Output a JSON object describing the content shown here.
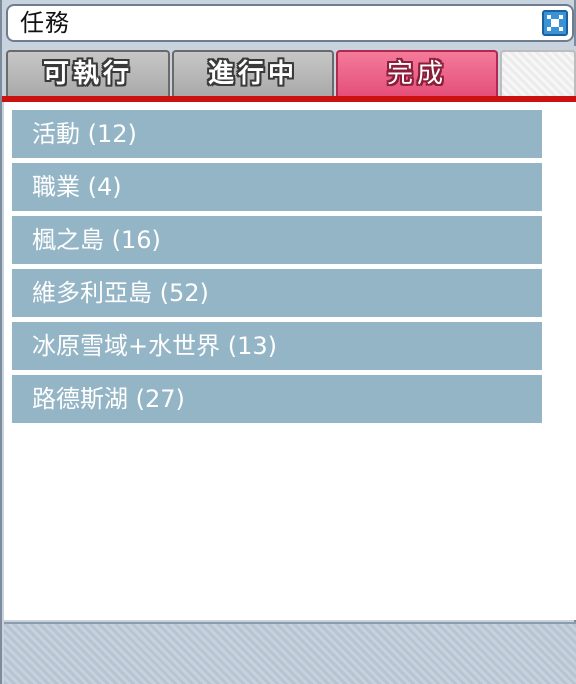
{
  "window": {
    "title": "任務",
    "close_icon": "close-icon"
  },
  "tabs": [
    {
      "label": "可執行",
      "active": false
    },
    {
      "label": "進行中",
      "active": false
    },
    {
      "label": "完成",
      "active": true
    }
  ],
  "colors": {
    "active_tab": "#e45079",
    "inactive_tab": "#b8b8b8",
    "divider": "#cc1111",
    "list_item": "#94b5c6"
  },
  "quest_categories": [
    {
      "label": "活動 (12)"
    },
    {
      "label": "職業 (4)"
    },
    {
      "label": "楓之島 (16)"
    },
    {
      "label": "維多利亞島 (52)"
    },
    {
      "label": "冰原雪域+水世界 (13)"
    },
    {
      "label": "路德斯湖 (27)"
    }
  ]
}
